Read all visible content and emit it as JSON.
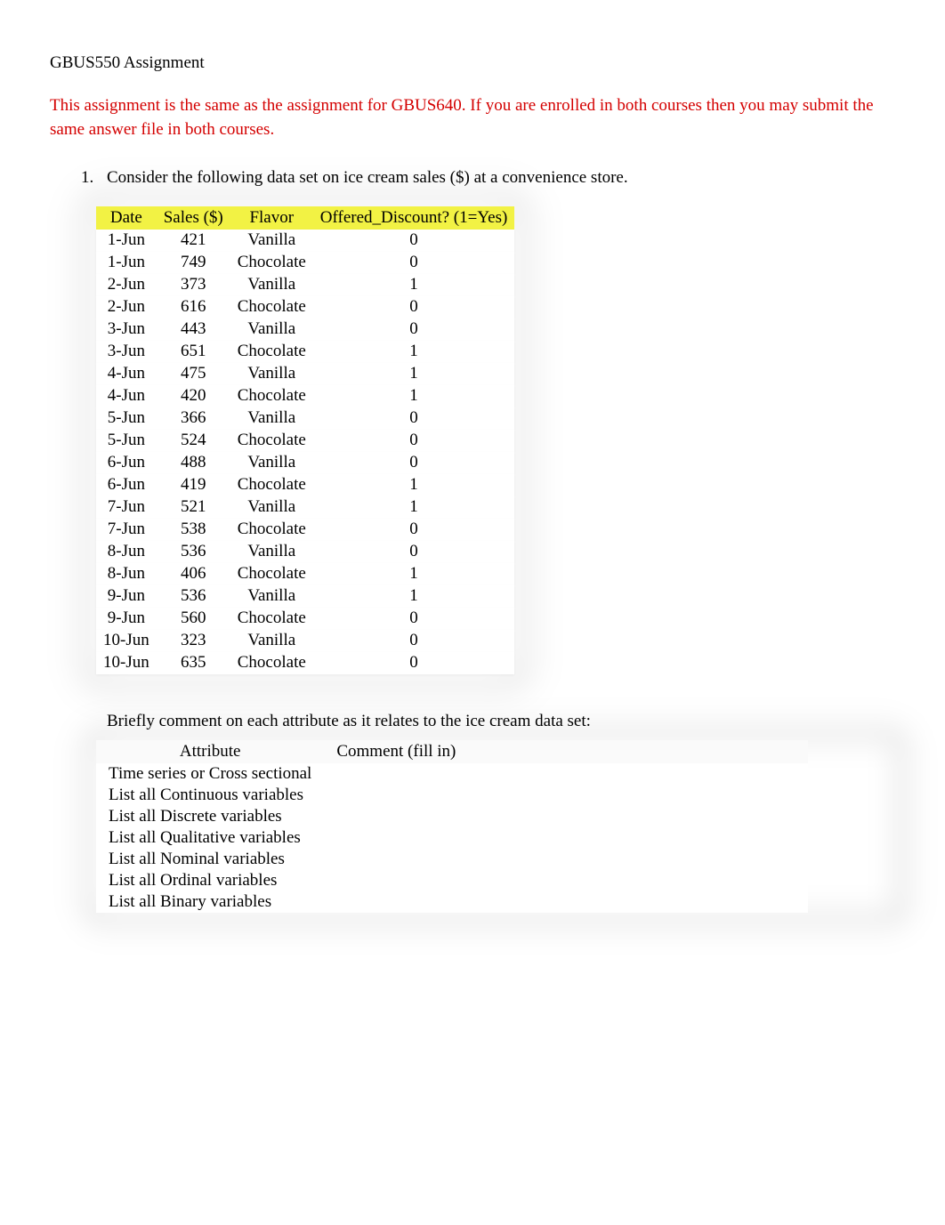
{
  "title": "GBUS550 Assignment",
  "notice": "This assignment is the same as the assignment for GBUS640. If you are enrolled in both courses then you may submit the same answer file in both courses.",
  "question1": {
    "number": "1.",
    "text": "Consider the following data set on ice cream sales ($) at a convenience store.",
    "table_headers": {
      "date": "Date",
      "sales": "Sales ($)",
      "flavor": "Flavor",
      "discount": "Offered_Discount? (1=Yes)"
    },
    "rows": [
      {
        "date": "1-Jun",
        "sales": "421",
        "flavor": "Vanilla",
        "discount": "0"
      },
      {
        "date": "1-Jun",
        "sales": "749",
        "flavor": "Chocolate",
        "discount": "0"
      },
      {
        "date": "2-Jun",
        "sales": "373",
        "flavor": "Vanilla",
        "discount": "1"
      },
      {
        "date": "2-Jun",
        "sales": "616",
        "flavor": "Chocolate",
        "discount": "0"
      },
      {
        "date": "3-Jun",
        "sales": "443",
        "flavor": "Vanilla",
        "discount": "0"
      },
      {
        "date": "3-Jun",
        "sales": "651",
        "flavor": "Chocolate",
        "discount": "1"
      },
      {
        "date": "4-Jun",
        "sales": "475",
        "flavor": "Vanilla",
        "discount": "1"
      },
      {
        "date": "4-Jun",
        "sales": "420",
        "flavor": "Chocolate",
        "discount": "1"
      },
      {
        "date": "5-Jun",
        "sales": "366",
        "flavor": "Vanilla",
        "discount": "0"
      },
      {
        "date": "5-Jun",
        "sales": "524",
        "flavor": "Chocolate",
        "discount": "0"
      },
      {
        "date": "6-Jun",
        "sales": "488",
        "flavor": "Vanilla",
        "discount": "0"
      },
      {
        "date": "6-Jun",
        "sales": "419",
        "flavor": "Chocolate",
        "discount": "1"
      },
      {
        "date": "7-Jun",
        "sales": "521",
        "flavor": "Vanilla",
        "discount": "1"
      },
      {
        "date": "7-Jun",
        "sales": "538",
        "flavor": "Chocolate",
        "discount": "0"
      },
      {
        "date": "8-Jun",
        "sales": "536",
        "flavor": "Vanilla",
        "discount": "0"
      },
      {
        "date": "8-Jun",
        "sales": "406",
        "flavor": "Chocolate",
        "discount": "1"
      },
      {
        "date": "9-Jun",
        "sales": "536",
        "flavor": "Vanilla",
        "discount": "1"
      },
      {
        "date": "9-Jun",
        "sales": "560",
        "flavor": "Chocolate",
        "discount": "0"
      },
      {
        "date": "10-Jun",
        "sales": "323",
        "flavor": "Vanilla",
        "discount": "0"
      },
      {
        "date": "10-Jun",
        "sales": "635",
        "flavor": "Chocolate",
        "discount": "0"
      }
    ],
    "comment_prompt": "Briefly comment on each attribute as it relates to the ice cream data set:",
    "attr_headers": {
      "attribute": "Attribute",
      "comment": "Comment (fill in)"
    },
    "attributes": [
      {
        "label": "Time series or Cross sectional",
        "comment": ""
      },
      {
        "label": "List all Continuous variables",
        "comment": ""
      },
      {
        "label": "List all Discrete variables",
        "comment": ""
      },
      {
        "label": "List all Qualitative variables",
        "comment": ""
      },
      {
        "label": "List all Nominal variables",
        "comment": ""
      },
      {
        "label": "List all Ordinal variables",
        "comment": ""
      },
      {
        "label": "List all Binary variables",
        "comment": ""
      }
    ]
  }
}
